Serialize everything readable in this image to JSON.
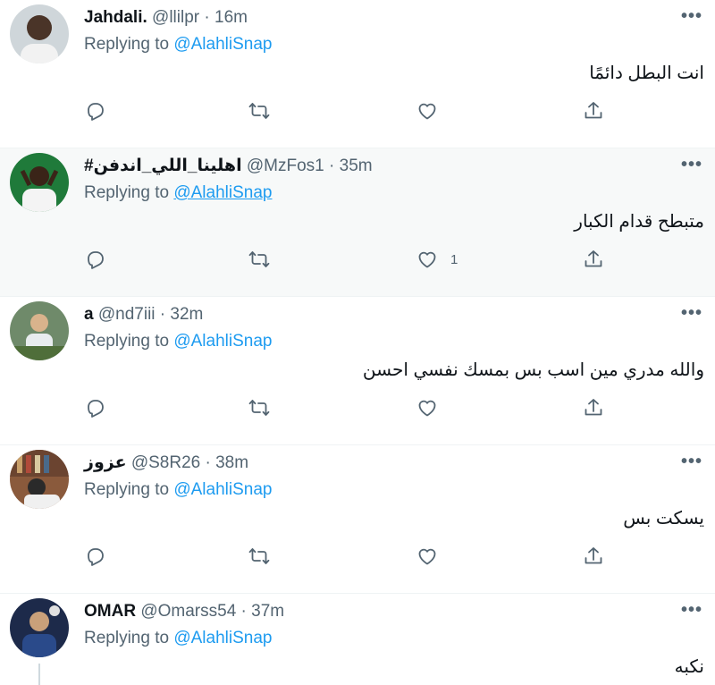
{
  "replying_prefix": "Replying to",
  "tweets": [
    {
      "name": "Jahdali.",
      "handle": "@llilpr",
      "time": "16m",
      "replying_to": "@AlahliSnap",
      "text": "انت البطل دائمًا",
      "likes": ""
    },
    {
      "name": "#اهلينا_اللي_اندفن",
      "handle": "@MzFos1",
      "time": "35m",
      "replying_to": "@AlahliSnap",
      "text": "متبطح قدام الكبار",
      "likes": "1"
    },
    {
      "name": "a",
      "handle": "@nd7iii",
      "time": "32m",
      "replying_to": "@AlahliSnap",
      "text": "والله مدري مين اسب بس بمسك نفسي احسن",
      "likes": ""
    },
    {
      "name": "عزوز",
      "handle": "@S8R26",
      "time": "38m",
      "replying_to": "@AlahliSnap",
      "text": "يسكت بس",
      "likes": ""
    },
    {
      "name": "OMAR",
      "handle": "@Omarss54",
      "time": "37m",
      "replying_to": "@AlahliSnap",
      "text": "نكبه",
      "likes": ""
    }
  ],
  "separator": "·",
  "more_glyph": "•••",
  "colors": {
    "link": "#1d9bf0",
    "secondary": "#536471",
    "highlight_bg": "#f7f9f9"
  }
}
